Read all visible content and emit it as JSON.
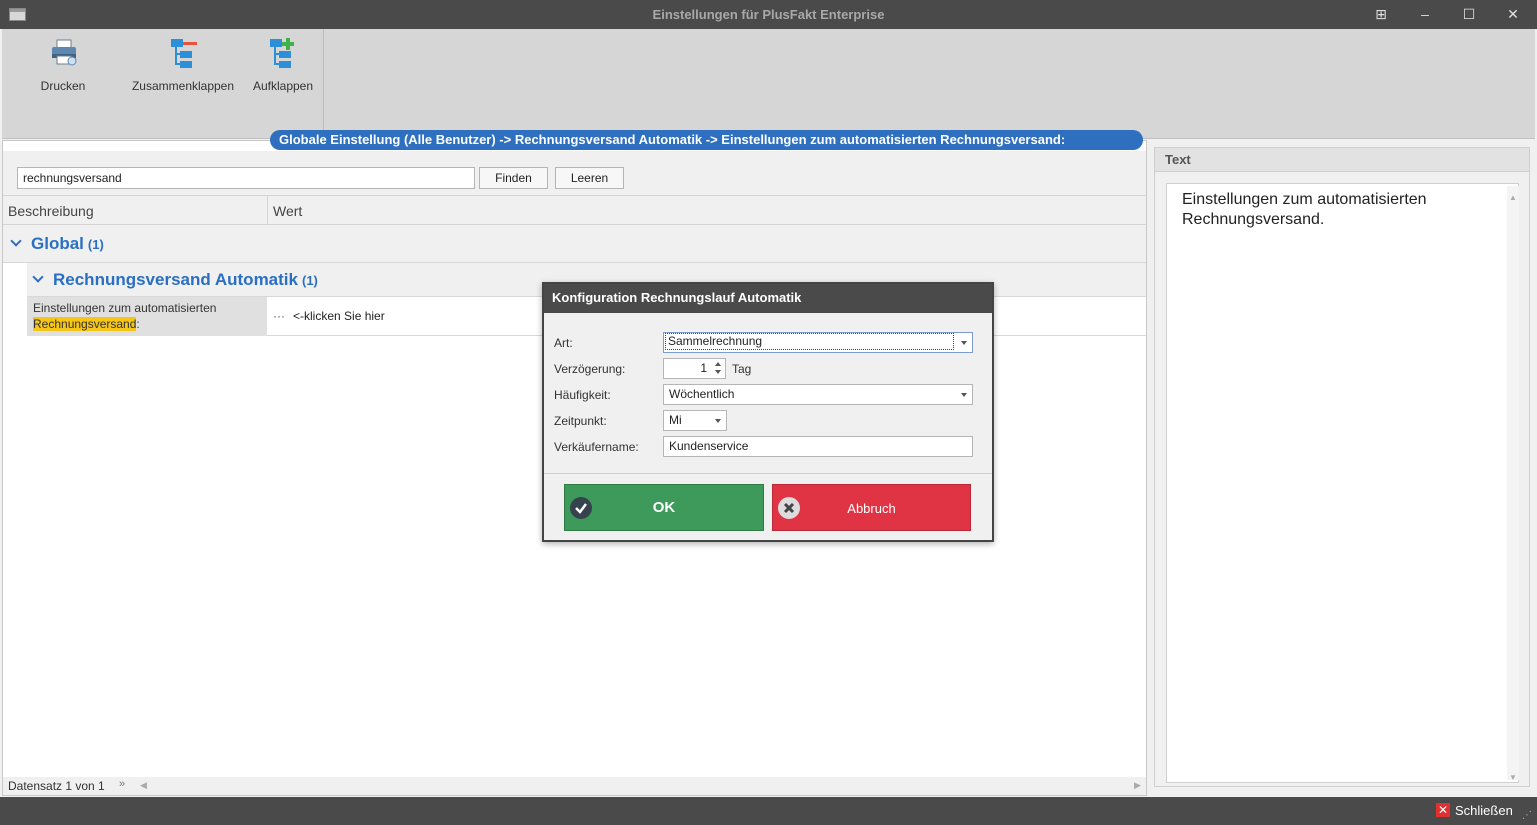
{
  "window": {
    "title": "Einstellungen für PlusFakt Enterprise"
  },
  "ribbon": {
    "print_label": "Drucken",
    "collapse_label": "Zusammenklappen",
    "expand_label": "Aufklappen"
  },
  "breadcrumb": "Globale Einstellung (Alle Benutzer) -> Rechnungsversand Automatik -> Einstellungen zum automatisierten Rechnungsversand:",
  "search": {
    "value": "rechnungsversand",
    "find_label": "Finden",
    "clear_label": "Leeren"
  },
  "grid": {
    "columns": [
      "Beschreibung",
      "Wert"
    ],
    "group1": {
      "label": "Global",
      "count": "(1)"
    },
    "group2": {
      "label": "Rechnungsversand Automatik",
      "count": "(1)"
    },
    "row": {
      "desc_line1": "Einstellungen zum automatisierten",
      "desc_highlight": "Rechnungsversand",
      "desc_suffix": ":",
      "ellipsis": "···",
      "value": "<-klicken Sie hier"
    },
    "record_status": "Datensatz 1 von 1"
  },
  "text_panel": {
    "header": "Text",
    "content": "Einstellungen zum automatisierten Rechnungsversand."
  },
  "dialog": {
    "title": "Konfiguration Rechnungslauf Automatik",
    "art_label": "Art:",
    "art_value": "Sammelrechnung",
    "delay_label": "Verzögerung:",
    "delay_value": "1",
    "delay_unit": "Tag",
    "frequency_label": "Häufigkeit:",
    "frequency_value": "Wöchentlich",
    "time_label": "Zeitpunkt:",
    "time_value": "Mi",
    "seller_label": "Verkäufername:",
    "seller_value": "Kundenservice",
    "ok_label": "OK",
    "cancel_label": "Abbruch"
  },
  "statusbar": {
    "close_label": "Schließen"
  },
  "colors": {
    "accent_blue": "#2a6fc3",
    "ok_green": "#3e9a5a",
    "cancel_red": "#e03444",
    "highlight_yellow": "#f5c518",
    "chrome_dark": "#4a4a4a"
  }
}
